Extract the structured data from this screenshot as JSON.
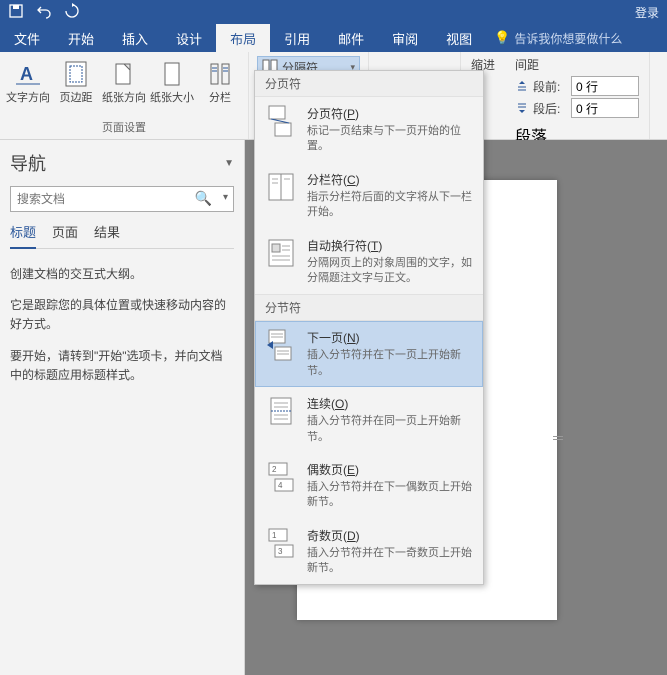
{
  "titlebar": {
    "right_label": "登录"
  },
  "tabs": {
    "file": "文件",
    "home": "开始",
    "insert": "插入",
    "design": "设计",
    "layout": "布局",
    "references": "引用",
    "mailings": "邮件",
    "review": "审阅",
    "view": "视图",
    "tellme": "告诉我你想要做什么"
  },
  "ribbon": {
    "page_setup_group": "页面设置",
    "text_direction": "文字方向",
    "margins": "页边距",
    "orientation": "纸张方向",
    "size": "纸张大小",
    "columns": "分栏",
    "breaks": "分隔符",
    "indent_label": "缩进",
    "spacing_label": "间距",
    "before_label": "段前:",
    "after_label": "段后:",
    "before_value": "0 行",
    "after_value": "0 行",
    "paragraph_group": "段落"
  },
  "nav": {
    "title": "导航",
    "search_placeholder": "搜索文档",
    "tab_headings": "标题",
    "tab_pages": "页面",
    "tab_results": "结果",
    "desc1": "创建文档的交互式大纲。",
    "desc2": "它是跟踪您的具体位置或快速移动内容的好方式。",
    "desc3": "要开始，请转到\"开始\"选项卡，并向文档中的标题应用标题样式。"
  },
  "dropdown": {
    "section1": "分页符",
    "section2": "分节符",
    "items": {
      "page_break": {
        "title_pre": "分页符(",
        "key": "P",
        "title_post": ")",
        "desc": "标记一页结束与下一页开始的位置。"
      },
      "column_break": {
        "title_pre": "分栏符(",
        "key": "C",
        "title_post": ")",
        "desc": "指示分栏符后面的文字将从下一栏开始。"
      },
      "text_wrap": {
        "title_pre": "自动换行符(",
        "key": "T",
        "title_post": ")",
        "desc": "分隔网页上的对象周围的文字，如分隔题注文字与正文。"
      },
      "next_page": {
        "title_pre": "下一页(",
        "key": "N",
        "title_post": ")",
        "desc": "插入分节符并在下一页上开始新节。"
      },
      "continuous": {
        "title_pre": "连续(",
        "key": "O",
        "title_post": ")",
        "desc": "插入分节符并在同一页上开始新节。"
      },
      "even_page": {
        "title_pre": "偶数页(",
        "key": "E",
        "title_post": ")",
        "desc": "插入分节符并在下一偶数页上开始新节。"
      },
      "odd_page": {
        "title_pre": "奇数页(",
        "key": "D",
        "title_post": ")",
        "desc": "插入分节符并在下一奇数页上开始新节。"
      }
    }
  }
}
